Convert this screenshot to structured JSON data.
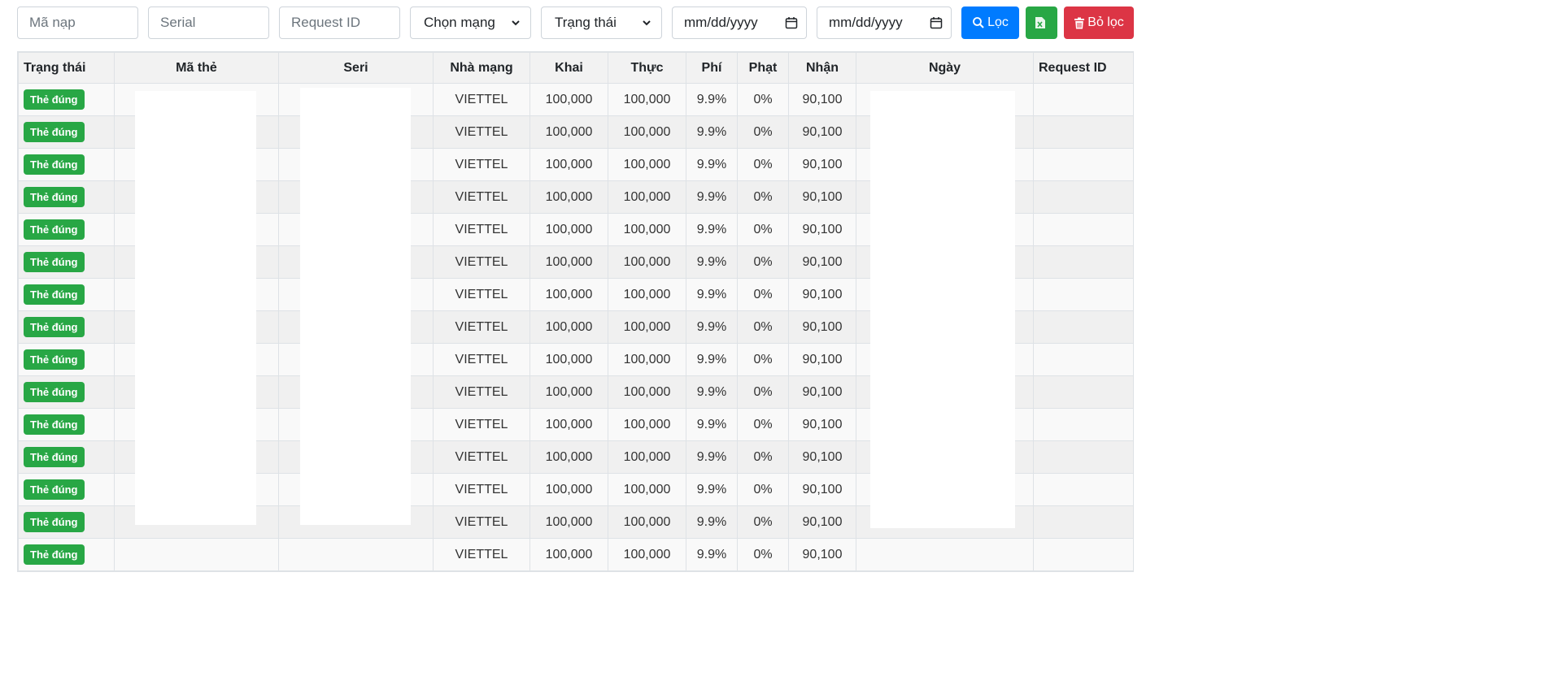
{
  "filters": {
    "ma_nap_placeholder": "Mã nạp",
    "serial_placeholder": "Serial",
    "request_id_placeholder": "Request ID",
    "network_select": "Chọn mạng",
    "status_select": "Trạng thái",
    "date_from": "mm/dd/yyyy",
    "date_to": "mm/dd/yyyy",
    "filter_button": "Lọc",
    "clear_button": "Bỏ lọc"
  },
  "table": {
    "headers": [
      "Trạng thái",
      "Mã thẻ",
      "Seri",
      "Nhà mạng",
      "Khai",
      "Thực",
      "Phí",
      "Phạt",
      "Nhận",
      "Ngày",
      "Request ID"
    ],
    "rows": [
      {
        "status": "Thẻ đúng",
        "network": "VIETTEL",
        "declared": "100,000",
        "actual": "100,000",
        "fee": "9.9%",
        "penalty": "0%",
        "received": "90,100"
      },
      {
        "status": "Thẻ đúng",
        "network": "VIETTEL",
        "declared": "100,000",
        "actual": "100,000",
        "fee": "9.9%",
        "penalty": "0%",
        "received": "90,100"
      },
      {
        "status": "Thẻ đúng",
        "network": "VIETTEL",
        "declared": "100,000",
        "actual": "100,000",
        "fee": "9.9%",
        "penalty": "0%",
        "received": "90,100"
      },
      {
        "status": "Thẻ đúng",
        "network": "VIETTEL",
        "declared": "100,000",
        "actual": "100,000",
        "fee": "9.9%",
        "penalty": "0%",
        "received": "90,100"
      },
      {
        "status": "Thẻ đúng",
        "network": "VIETTEL",
        "declared": "100,000",
        "actual": "100,000",
        "fee": "9.9%",
        "penalty": "0%",
        "received": "90,100"
      },
      {
        "status": "Thẻ đúng",
        "network": "VIETTEL",
        "declared": "100,000",
        "actual": "100,000",
        "fee": "9.9%",
        "penalty": "0%",
        "received": "90,100"
      },
      {
        "status": "Thẻ đúng",
        "network": "VIETTEL",
        "declared": "100,000",
        "actual": "100,000",
        "fee": "9.9%",
        "penalty": "0%",
        "received": "90,100"
      },
      {
        "status": "Thẻ đúng",
        "network": "VIETTEL",
        "declared": "100,000",
        "actual": "100,000",
        "fee": "9.9%",
        "penalty": "0%",
        "received": "90,100"
      },
      {
        "status": "Thẻ đúng",
        "network": "VIETTEL",
        "declared": "100,000",
        "actual": "100,000",
        "fee": "9.9%",
        "penalty": "0%",
        "received": "90,100"
      },
      {
        "status": "Thẻ đúng",
        "network": "VIETTEL",
        "declared": "100,000",
        "actual": "100,000",
        "fee": "9.9%",
        "penalty": "0%",
        "received": "90,100"
      },
      {
        "status": "Thẻ đúng",
        "network": "VIETTEL",
        "declared": "100,000",
        "actual": "100,000",
        "fee": "9.9%",
        "penalty": "0%",
        "received": "90,100"
      },
      {
        "status": "Thẻ đúng",
        "network": "VIETTEL",
        "declared": "100,000",
        "actual": "100,000",
        "fee": "9.9%",
        "penalty": "0%",
        "received": "90,100"
      },
      {
        "status": "Thẻ đúng",
        "network": "VIETTEL",
        "declared": "100,000",
        "actual": "100,000",
        "fee": "9.9%",
        "penalty": "0%",
        "received": "90,100"
      },
      {
        "status": "Thẻ đúng",
        "network": "VIETTEL",
        "declared": "100,000",
        "actual": "100,000",
        "fee": "9.9%",
        "penalty": "0%",
        "received": "90,100"
      },
      {
        "status": "Thẻ đúng",
        "network": "VIETTEL",
        "declared": "100,000",
        "actual": "100,000",
        "fee": "9.9%",
        "penalty": "0%",
        "received": "90,100"
      }
    ]
  },
  "colors": {
    "badge_success": "#28a745",
    "btn_primary": "#007bff",
    "btn_success": "#28a745",
    "btn_danger": "#dc3545"
  }
}
